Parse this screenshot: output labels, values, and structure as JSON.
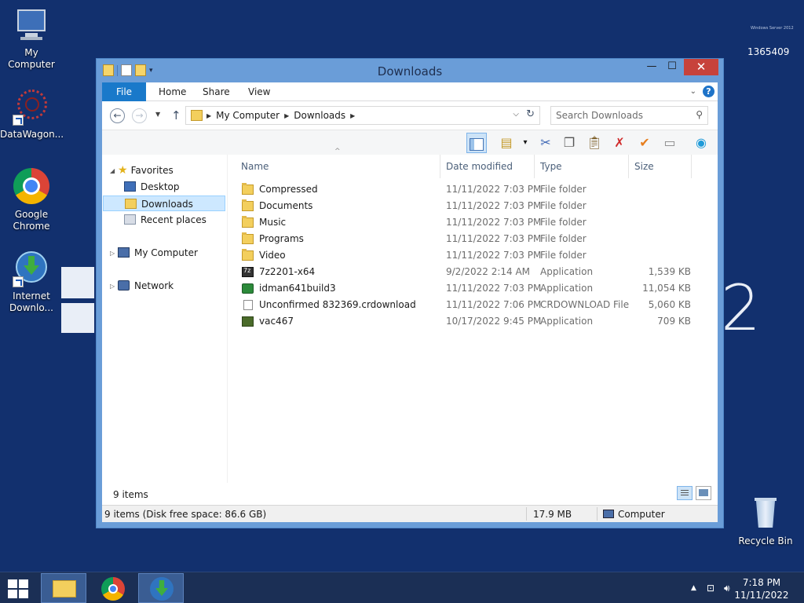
{
  "desktop": {
    "icons": [
      {
        "id": "my-computer",
        "label": "My Computer"
      },
      {
        "id": "datawagon",
        "label": "DataWagon..."
      },
      {
        "id": "chrome",
        "label": "Google Chrome"
      },
      {
        "id": "idm",
        "label": "Internet Downlo..."
      },
      {
        "id": "recycle",
        "label": "Recycle Bin"
      }
    ],
    "watermark_number": "1365409",
    "watermark_text": "Windows Server 2012",
    "big_digit": "2"
  },
  "window": {
    "title": "Downloads",
    "controls": {
      "minimize": "—",
      "maximize": "☐",
      "close": "✕"
    },
    "ribbon_tabs": [
      "File",
      "Home",
      "Share",
      "View"
    ],
    "address": {
      "crumbs": [
        "My Computer",
        "Downloads"
      ]
    },
    "search": {
      "placeholder": "Search Downloads"
    },
    "nav": {
      "favorites": "Favorites",
      "desktop": "Desktop",
      "downloads": "Downloads",
      "recent": "Recent places",
      "my_computer": "My Computer",
      "network": "Network"
    },
    "columns": {
      "name": "Name",
      "date": "Date modified",
      "type": "Type",
      "size": "Size"
    },
    "files": [
      {
        "name": "Compressed",
        "date": "11/11/2022 7:03 PM",
        "type": "File folder",
        "size": "",
        "icon": "folder"
      },
      {
        "name": "Documents",
        "date": "11/11/2022 7:03 PM",
        "type": "File folder",
        "size": "",
        "icon": "folder"
      },
      {
        "name": "Music",
        "date": "11/11/2022 7:03 PM",
        "type": "File folder",
        "size": "",
        "icon": "folder"
      },
      {
        "name": "Programs",
        "date": "11/11/2022 7:03 PM",
        "type": "File folder",
        "size": "",
        "icon": "folder"
      },
      {
        "name": "Video",
        "date": "11/11/2022 7:03 PM",
        "type": "File folder",
        "size": "",
        "icon": "folder"
      },
      {
        "name": "7z2201-x64",
        "date": "9/2/2022 2:14 AM",
        "type": "Application",
        "size": "1,539 KB",
        "icon": "app"
      },
      {
        "name": "idman641build3",
        "date": "11/11/2022 7:03 PM",
        "type": "Application",
        "size": "11,054 KB",
        "icon": "idm"
      },
      {
        "name": "Unconfirmed 832369.crdownload",
        "date": "11/11/2022 7:06 PM",
        "type": "CRDOWNLOAD File",
        "size": "5,060 KB",
        "icon": "doc"
      },
      {
        "name": "vac467",
        "date": "10/17/2022 9:45 PM",
        "type": "Application",
        "size": "709 KB",
        "icon": "vac"
      }
    ],
    "item_count": "9 items",
    "status": {
      "left": "9 items (Disk free space: 86.6 GB)",
      "size": "17.9 MB",
      "location": "Computer"
    }
  },
  "taskbar": {
    "time": "7:18 PM",
    "date": "11/11/2022"
  }
}
